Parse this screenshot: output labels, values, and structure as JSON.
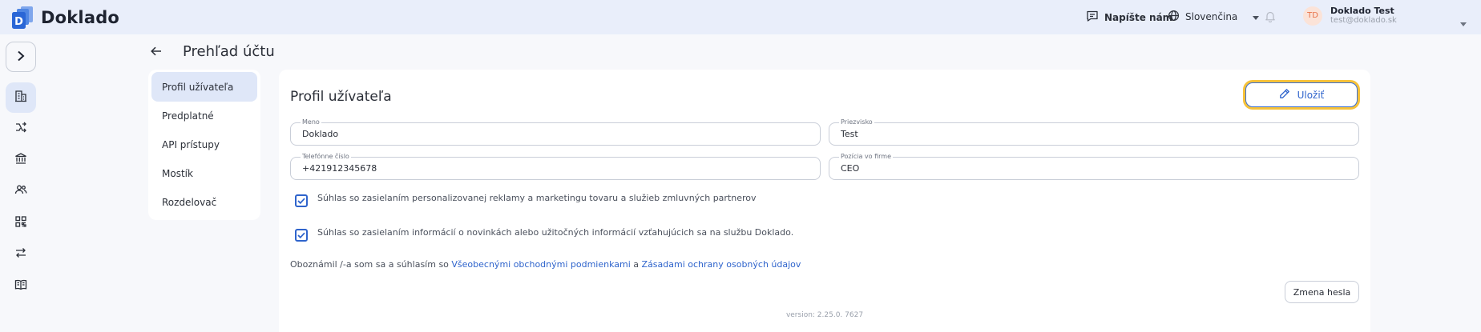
{
  "app": {
    "name": "Doklado"
  },
  "header": {
    "contact_label": "Napíšte nám",
    "language": "Slovenčina",
    "user": {
      "initials": "TD",
      "name": "Doklado Test",
      "email": "test@doklado.sk"
    }
  },
  "sidebar": {
    "icons": [
      "building-icon",
      "share-icon",
      "bank-icon",
      "users-icon",
      "qr-code-icon",
      "transfer-icon",
      "book-icon"
    ]
  },
  "page": {
    "title": "Prehľad účtu"
  },
  "menu": {
    "items": [
      {
        "label": "Profil užívateľa",
        "active": true
      },
      {
        "label": "Predplatné",
        "active": false
      },
      {
        "label": "API prístupy",
        "active": false
      },
      {
        "label": "Mostík",
        "active": false
      },
      {
        "label": "Rozdelovač",
        "active": false
      }
    ]
  },
  "profile": {
    "title": "Profil užívateľa",
    "save_label": "Uložiť",
    "fields": {
      "first_name": {
        "label": "Meno",
        "value": "Doklado"
      },
      "last_name": {
        "label": "Priezvisko",
        "value": "Test"
      },
      "phone": {
        "label": "Telefónne číslo",
        "value": "+421912345678"
      },
      "position": {
        "label": "Pozícia vo firme",
        "value": "CEO"
      }
    },
    "consents": [
      {
        "text": "Súhlas so zasielaním personalizovanej reklamy a marketingu tovaru a služieb zmluvných partnerov",
        "checked": true
      },
      {
        "text": "Súhlas so zasielaním informácií o novinkách alebo užitočných informácií vzťahujúcich sa na službu Doklado.",
        "checked": true
      }
    ],
    "terms": {
      "prefix": "Oboznámil /-a som sa a súhlasím so ",
      "link1": "Všeobecnými obchodnými podmienkami",
      "middle": " a ",
      "link2": "Zásadami ochrany osobných údajov"
    },
    "change_password_label": "Zmena hesla",
    "version": "version: 2.25.0. 7627"
  },
  "colors": {
    "accent": "#2f64cc",
    "highlight": "#f6c23a",
    "header_bg": "#e9eefa",
    "active_bg": "#dfe7f8"
  }
}
